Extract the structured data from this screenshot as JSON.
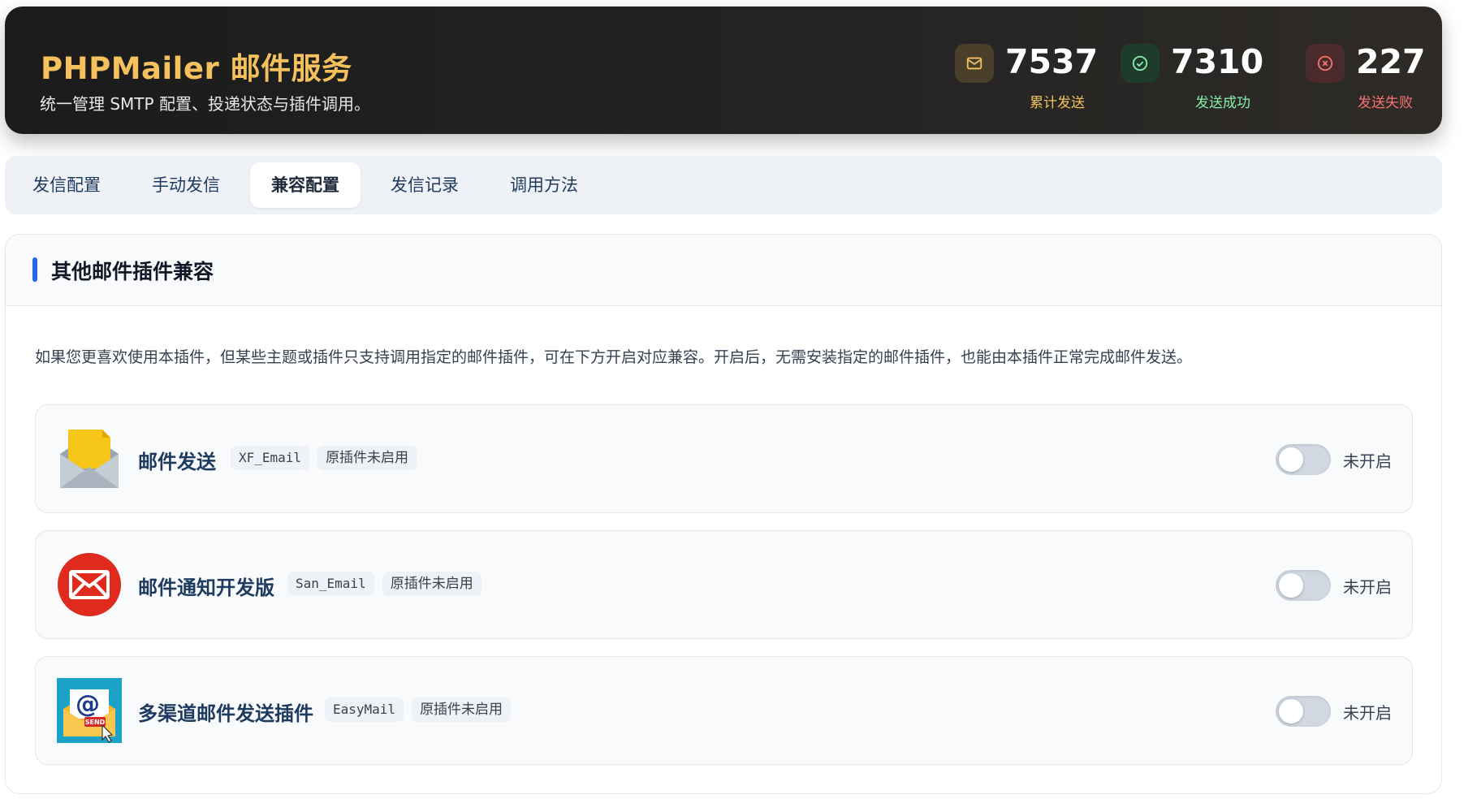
{
  "header": {
    "title": "PHPMailer 邮件服务",
    "subtitle": "统一管理 SMTP 配置、投递状态与插件调用。",
    "stats": {
      "total": {
        "value": "7537",
        "label": "累计发送",
        "icon": "mail-icon",
        "color": "#f4c15d"
      },
      "success": {
        "value": "7310",
        "label": "发送成功",
        "icon": "check-circle-icon",
        "color": "#86efac"
      },
      "failed": {
        "value": "227",
        "label": "发送失败",
        "icon": "x-circle-icon",
        "color": "#f87171"
      }
    }
  },
  "tabs": [
    {
      "label": "发信配置",
      "active": false
    },
    {
      "label": "手动发信",
      "active": false
    },
    {
      "label": "兼容配置",
      "active": true
    },
    {
      "label": "发信记录",
      "active": false
    },
    {
      "label": "调用方法",
      "active": false
    }
  ],
  "panel": {
    "title": "其他邮件插件兼容",
    "description": "如果您更喜欢使用本插件，但某些主题或插件只支持调用指定的邮件插件，可在下方开启对应兼容。开启后，无需安装指定的邮件插件，也能由本插件正常完成邮件发送。",
    "accent_color": "#2563eb",
    "plugins": [
      {
        "name": "邮件发送",
        "code": "XF_Email",
        "status_tag": "原插件未启用",
        "toggle_on": false,
        "toggle_label": "未开启",
        "icon": "open-envelope-icon"
      },
      {
        "name": "邮件通知开发版",
        "code": "San_Email",
        "status_tag": "原插件未启用",
        "toggle_on": false,
        "toggle_label": "未开启",
        "icon": "red-envelope-icon"
      },
      {
        "name": "多渠道邮件发送插件",
        "code": "EasyMail",
        "status_tag": "原插件未启用",
        "toggle_on": false,
        "toggle_label": "未开启",
        "icon": "send-mail-icon"
      }
    ]
  }
}
